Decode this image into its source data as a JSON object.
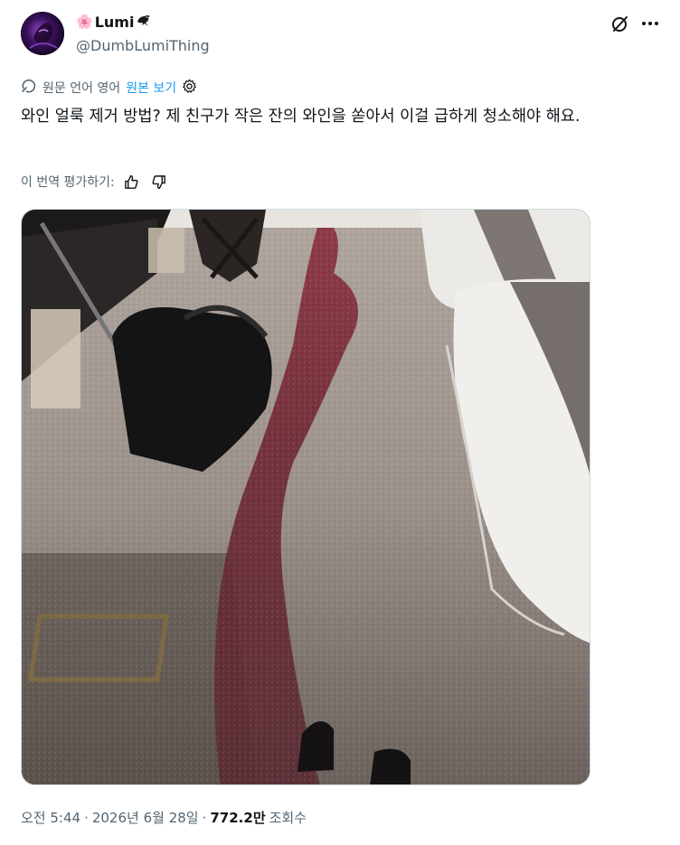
{
  "author": {
    "display_name": "Lumi",
    "handle": "@DumbLumiThing",
    "name_emoji_prefix": "🌸",
    "name_emoji_suffix": "🐦‍⬛"
  },
  "translation": {
    "original_language_label": "원문 언어 영어",
    "show_original_label": "원본 보기"
  },
  "tweet": {
    "text": "와인 얼룩 제거 방법? 제 친구가 작은 잔의 와인을 쏟아서 이걸 급하게 청소해야 해요."
  },
  "rating": {
    "label": "이 번역 평가하기:"
  },
  "meta": {
    "time": "오전 5:44",
    "separator1": "·",
    "date": "2026년 6월 28일",
    "separator2": "·",
    "views_count": "772.2만",
    "views_label": "조회수"
  },
  "icons": {
    "grok": "grok-icon",
    "more": "more-icon",
    "translate": "translate-icon",
    "gear": "gear-icon",
    "thumbs_up": "thumbs-up-icon",
    "thumbs_down": "thumbs-down-icon"
  },
  "colors": {
    "link": "#1d9bf0",
    "secondary_text": "#536471",
    "primary_text": "#0f1419"
  }
}
